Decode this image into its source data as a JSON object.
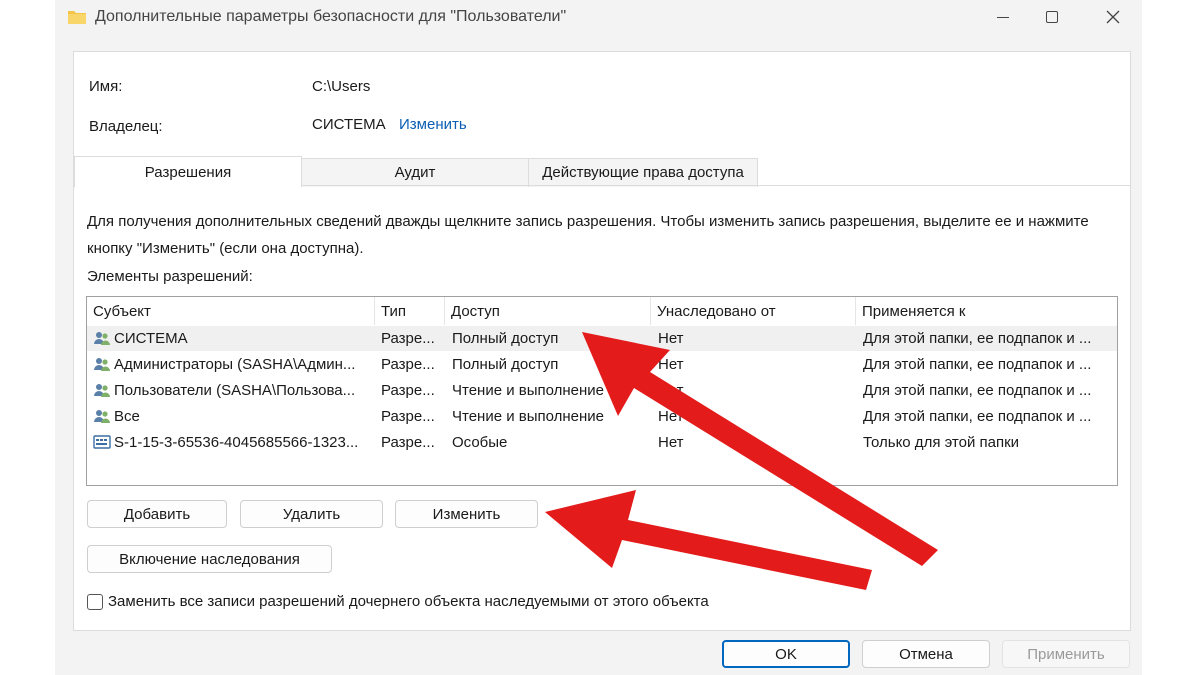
{
  "window": {
    "title": "Дополнительные параметры безопасности  для \"Пользователи\"",
    "icons": {
      "app": "folder-icon",
      "minimize": "minimize-icon",
      "maximize": "maximize-icon",
      "close": "close-icon"
    }
  },
  "header": {
    "name_label": "Имя:",
    "name_value": "C:\\Users",
    "owner_label": "Владелец:",
    "owner_value": "СИСТЕМА",
    "owner_change": "Изменить"
  },
  "tabs": [
    {
      "label": "Разрешения",
      "active": true
    },
    {
      "label": "Аудит",
      "active": false
    },
    {
      "label": "Действующие права доступа",
      "active": false
    }
  ],
  "info_text": "Для получения дополнительных сведений дважды щелкните запись разрешения. Чтобы изменить запись разрешения, выделите ее и нажмите кнопку \"Изменить\" (если она доступна).",
  "entries_label": "Элементы разрешений:",
  "table": {
    "columns": [
      "Субъект",
      "Тип",
      "Доступ",
      "Унаследовано от",
      "Применяется к"
    ],
    "rows": [
      {
        "icon": "users-group-icon",
        "subject": "СИСТЕМА",
        "type": "Разре...",
        "access": "Полный доступ",
        "inherited": "Нет",
        "applies": "Для этой папки, ее подпапок и ..."
      },
      {
        "icon": "users-group-icon",
        "subject": "Администраторы (SASHA\\Админ...",
        "type": "Разре...",
        "access": "Полный доступ",
        "inherited": "Нет",
        "applies": "Для этой папки, ее подпапок и ..."
      },
      {
        "icon": "users-group-icon",
        "subject": "Пользователи (SASHA\\Пользова...",
        "type": "Разре...",
        "access": "Чтение и выполнение",
        "inherited": "Нет",
        "applies": "Для этой папки, ее подпапок и ..."
      },
      {
        "icon": "users-group-icon",
        "subject": "Все",
        "type": "Разре...",
        "access": "Чтение и выполнение",
        "inherited": "Нет",
        "applies": "Для этой папки, ее подпапок и ..."
      },
      {
        "icon": "app-package-icon",
        "subject": "S-1-15-3-65536-4045685566-1323...",
        "type": "Разре...",
        "access": "Особые",
        "inherited": "Нет",
        "applies": "Только для этой папки"
      }
    ]
  },
  "buttons": {
    "add": "Добавить",
    "remove": "Удалить",
    "edit": "Изменить",
    "inherit": "Включение наследования",
    "replace_checkbox": "Заменить все записи разрешений дочернего объекта наследуемыми от этого объекта",
    "ok": "OK",
    "cancel": "Отмена",
    "apply": "Применить"
  },
  "annotation": {
    "arrow_color": "#e31b1b"
  },
  "colors": {
    "link": "#0a5fb4",
    "accent": "#0067c0"
  }
}
